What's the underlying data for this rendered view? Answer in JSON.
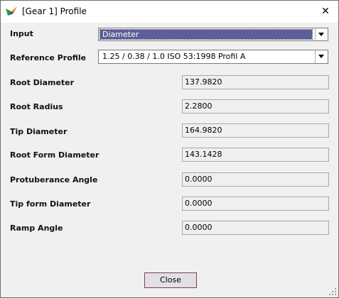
{
  "window": {
    "title": "[Gear 1] Profile",
    "close_glyph": "✕"
  },
  "fields": {
    "input": {
      "label": "Input",
      "value": "Diameter"
    },
    "reference_profile": {
      "label": "Reference Profile",
      "value": "1.25 / 0.38 / 1.0 ISO 53:1998 Profil A"
    },
    "root_diameter": {
      "label": "Root Diameter",
      "value": "137.9820"
    },
    "root_radius": {
      "label": "Root Radius",
      "value": "2.2800"
    },
    "tip_diameter": {
      "label": "Tip Diameter",
      "value": "164.9820"
    },
    "root_form_diameter": {
      "label": "Root Form Diameter",
      "value": "143.1428"
    },
    "protuberance_angle": {
      "label": "Protuberance Angle",
      "value": "0.0000"
    },
    "tip_form_diameter": {
      "label": "Tip form Diameter",
      "value": "0.0000"
    },
    "ramp_angle": {
      "label": "Ramp Angle",
      "value": "0.0000"
    }
  },
  "footer": {
    "close_label": "Close"
  },
  "icons": {
    "app": "app-logo-icon",
    "close": "close-icon",
    "dropdown": "chevron-down-icon",
    "resize": "resize-grip-icon"
  },
  "colors": {
    "selection": "#5b5e99",
    "close_button_border": "#7a3b6a"
  }
}
